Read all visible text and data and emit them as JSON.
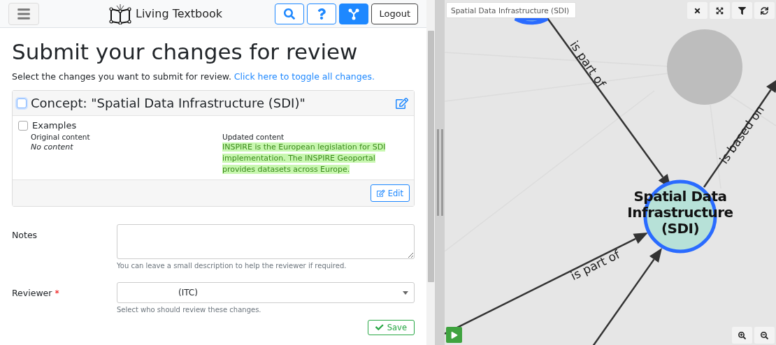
{
  "navbar": {
    "brand": "Living Textbook",
    "buttons": [
      {
        "kind": "search",
        "selected": false
      },
      {
        "kind": "help",
        "selected": false
      },
      {
        "kind": "graph",
        "selected": true
      }
    ],
    "logout": "Logout"
  },
  "page": {
    "title": "Submit your changes for review",
    "intro": "Select the changes you want to submit for review.",
    "toggle_link": "Click here to toggle all changes."
  },
  "concept_card": {
    "title": "Concept: \"Spatial Data Infrastructure (SDI)\"",
    "checked": false,
    "changes": [
      {
        "label": "Examples",
        "checked": false,
        "original_label": "Original content",
        "original": "No content",
        "updated_label": "Updated content",
        "updated": "INSPIRE is the European legislation for SDI implementation. The INSPIRE Geoportal provides datasets across Europe."
      }
    ],
    "edit_button": "Edit"
  },
  "form": {
    "notes_label": "Notes",
    "notes_help": "You can leave a small description to help the reviewer if required.",
    "reviewer_label": "Reviewer",
    "required_mark": "*",
    "reviewer_value": "(ITC)",
    "reviewer_help": "Select who should review these changes.",
    "save_button": "Save"
  },
  "graph": {
    "search_value": "Spatial Data Infrastructure (SDI)",
    "nodes": [
      {
        "kind": "highlighted"
      },
      {
        "kind": "faded"
      },
      {
        "kind": "highlighted",
        "lines": [
          "Spatial Data",
          "Infrastructure",
          "(SDI)"
        ]
      }
    ],
    "edges": [
      {
        "kind": "labeled",
        "label": "is part of"
      },
      {
        "kind": "labeled",
        "label": "is based on"
      },
      {
        "kind": "labeled",
        "label": "is part of"
      },
      {
        "kind": "plain"
      }
    ]
  }
}
